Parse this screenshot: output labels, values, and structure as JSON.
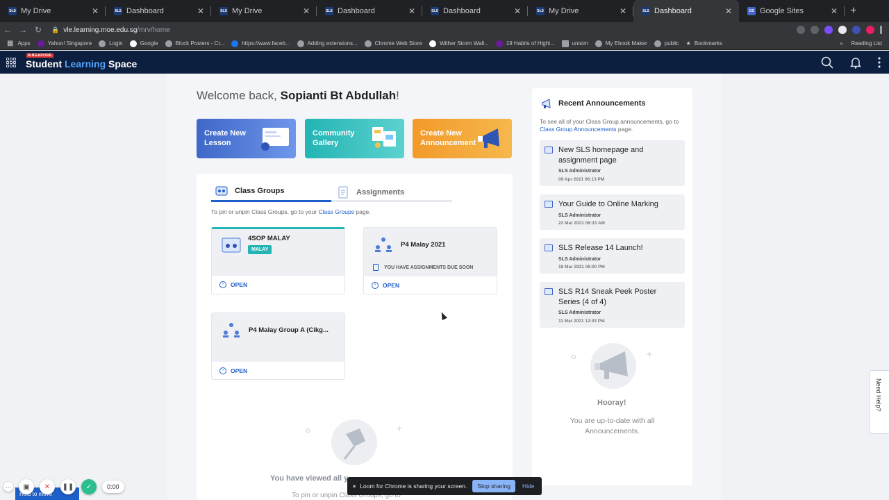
{
  "browser": {
    "tabs": [
      {
        "title": "My Drive",
        "favicon": "SLS"
      },
      {
        "title": "Dashboard",
        "favicon": "SLS"
      },
      {
        "title": "My Drive",
        "favicon": "SLS"
      },
      {
        "title": "Dashboard",
        "favicon": "SLS"
      },
      {
        "title": "Dashboard",
        "favicon": "SLS"
      },
      {
        "title": "My Drive",
        "favicon": "SLS"
      },
      {
        "title": "Dashboard",
        "favicon": "SLS",
        "active": true
      },
      {
        "title": "Google Sites",
        "favicon": "GS"
      }
    ],
    "url_host": "vle.learning.moe.edu.sg",
    "url_path": "/mrv/home",
    "bookmarks": [
      "Apps",
      "Yahoo! Singapore",
      "Login",
      "Google",
      "Block Posters - Cr...",
      "https://www.faceb...",
      "Adding extensions...",
      "Chrome Web Store",
      "Wither Storm Wall...",
      "19 Habits of Highl...",
      "unisim",
      "My Ebook Maker",
      "public",
      "Bookmarks"
    ],
    "reading_list": "Reading List"
  },
  "header": {
    "logo_badge": "SINGAPORE",
    "logo_part1": "Student ",
    "logo_part2": "Learning",
    "logo_part3": " Space"
  },
  "welcome": {
    "prefix": "Welcome back, ",
    "name": "Sopianti Bt Abdullah",
    "suffix": "!"
  },
  "quick_actions": [
    {
      "line1": "Create New",
      "line2": "Lesson",
      "color": "#4f7bd9"
    },
    {
      "line1": "Community",
      "line2": "Gallery",
      "color": "#34c0bf"
    },
    {
      "line1": "Create New",
      "line2": "Announcement",
      "color": "#f4a93a"
    }
  ],
  "tabs": {
    "class_groups": "Class Groups",
    "assignments": "Assignments"
  },
  "pin_note": {
    "prefix": "To pin or unpin Class Groups, go to your ",
    "link": "Class Groups",
    "suffix": " page."
  },
  "class_groups": [
    {
      "name": "4SOP MALAY",
      "chip": "MALAY",
      "open": "OPEN"
    },
    {
      "name": "P4 Malay 2021",
      "due": "YOU HAVE ASSIGNMENTS DUE SOON",
      "open": "OPEN"
    },
    {
      "name": "P4 Malay Group A (Cikg...",
      "open": "OPEN"
    }
  ],
  "empty": {
    "title": "You have viewed all y",
    "sub": "To pin or unpin Class Groups, go to"
  },
  "announcements": {
    "title": "Recent Announcements",
    "note_prefix": "To see all of your Class Group announcements, go to ",
    "note_link": "Class Group Announcements",
    "note_suffix": " page.",
    "items": [
      {
        "title": "New SLS homepage and assignment page",
        "by": "SLS Administrator",
        "date": "09 Apr 2021 06:13 PM"
      },
      {
        "title": "Your Guide to Online Marking",
        "by": "SLS Administrator",
        "date": "22 Mar 2021 06:33 AM"
      },
      {
        "title": "SLS Release 14 Launch!",
        "by": "SLS Administrator",
        "date": "18 Mar 2021 06:00 PM"
      },
      {
        "title": "SLS R14 Sneak Peek Poster Series (4 of 4)",
        "by": "SLS Administrator",
        "date": "11 Mar 2021 12:03 PM"
      }
    ],
    "hooray": "Hooray!",
    "uptodate": "You are up-to-date with all Announcements."
  },
  "help": "Need Help?",
  "loom": {
    "message": "Loom for Chrome is sharing your screen.",
    "stop": "Stop sharing",
    "hide": "Hide"
  },
  "recorder": {
    "time": "0:00",
    "hint": "Hold to move"
  }
}
